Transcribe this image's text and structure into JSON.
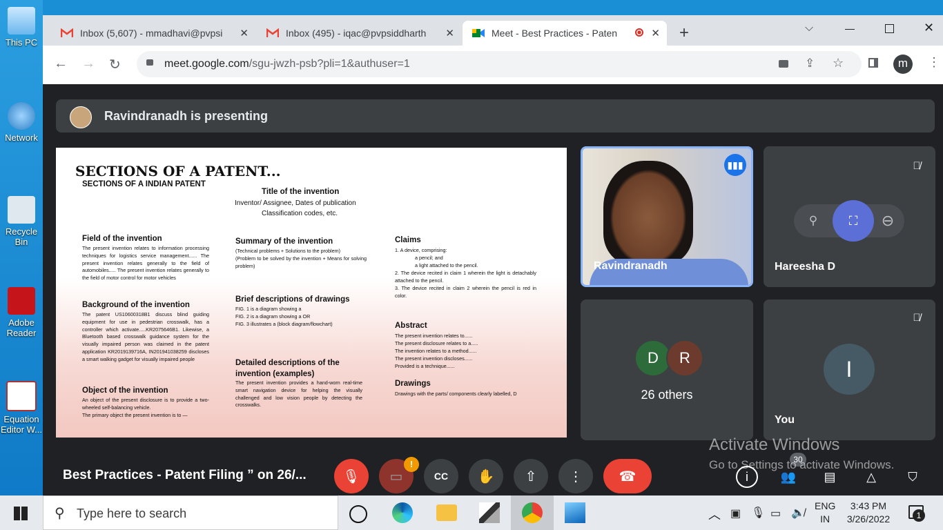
{
  "desktop": {
    "icons": [
      {
        "label": "This PC"
      },
      {
        "label": "Network"
      },
      {
        "label": "Recycle Bin"
      },
      {
        "label": "Adobe Reader"
      },
      {
        "label": "Equation Editor W..."
      }
    ]
  },
  "browser": {
    "tabs": [
      {
        "title": "Inbox (5,607) - mmadhavi@pvpsi",
        "icon": "gmail-icon"
      },
      {
        "title": "Inbox (495) - iqac@pvpsiddharth",
        "icon": "gmail-icon"
      },
      {
        "title": "Meet - Best Practices - Paten",
        "icon": "meet-icon",
        "active": true
      }
    ],
    "new_tab": "+",
    "url_host": "meet.google.com",
    "url_path": "/sgu-jwzh-psb?pli=1&authuser=1",
    "profile_initial": "m"
  },
  "meet": {
    "banner_text": "Ravindranadh is presenting",
    "slide": {
      "title": "SECTIONS OF A PATENT...",
      "subtitle": "SECTIONS OF A INDIAN PATENT",
      "title_invention": "Title of the invention",
      "title_lines": [
        "Inventor/ Assignee, Dates of publication",
        "Classification codes, etc."
      ],
      "field_head": "Field of the invention",
      "field_body": "The present invention relates to information processing techniques for logistics service management...... The present invention relates generally to the field of automobiles..... The present invention relates generally to the field of motor control for motor vehicles",
      "background_head": "Background of the invention",
      "background_body": "The patent US10600318B1 discuss blind guiding equipment for use in pedestrian crosswalk, has a controller which activate.....KR2075646B1. Likewise, a Bluetooth based crosswalk guidance system for the visually impaired person was claimed in the patent application KR2019139716A, IN201941038259 discloses a smart walking gadget for visually impaired people",
      "object_head": "Object of the invention",
      "object_body": [
        "An object of the present disclosure is to provide a two-wheeled self-balancing vehicle.",
        "The primary object the present invention is to —"
      ],
      "summary_head": "Summary of the invention",
      "summary_body": [
        "(Technical problems + Solutions to the problem)",
        "(Problem to be solved by the invention + Means for solving problem)"
      ],
      "brief_head": "Brief descriptions of drawings",
      "brief_body": [
        "FIG. 1 is a diagram showing a",
        "FIG. 2 is a diagram showing a OR",
        "FIG. 3 illustrates a (block diagram/flowchart)"
      ],
      "detailed_head": "Detailed descriptions of the invention (examples)",
      "detailed_body": "The present invention provides a hand-worn real-time smart navigation device for helping the visually challenged and low vision people by detecting the crosswalks.",
      "claims_head": "Claims",
      "claims_body": [
        "1. A device, comprising:",
        "a pencil; and",
        "a light attached to the pencil.",
        "2.   The device recited in claim 1 wherein the light is detachably attached to the pencil.",
        "3.   The device recited in claim 2 wherein the pencil is red in color."
      ],
      "abstract_head": "Abstract",
      "abstract_body": [
        "The present invention relates to......",
        "The present disclosure relates to a.....",
        "The invention relates to a method......",
        "The present invention discloses......",
        "Provided is a technique......"
      ],
      "drawings_head": "Drawings",
      "drawings_body": "Drawings with the parts/ components clearly labelled, D"
    },
    "participants": {
      "presenter": "Ravindranadh",
      "second": "Hareesha D",
      "others_label": "26 others",
      "others_avatars": [
        {
          "initial": "D",
          "color": "#2e6b3a"
        },
        {
          "initial": "R",
          "color": "#6d3b2e"
        }
      ],
      "you_label": "You",
      "you_initial": "I"
    },
    "meeting_title": "Best Practices - Patent Filing ” on 26/...",
    "people_count": "30",
    "camera_alert": "!"
  },
  "watermark": {
    "line1": "Activate Windows",
    "line2": "Go to Settings to activate Windows."
  },
  "taskbar": {
    "search_placeholder": "Type here to search",
    "lang_top": "ENG",
    "lang_bottom": "IN",
    "time": "3:43 PM",
    "date": "3/26/2022",
    "notif_count": "1"
  },
  "colors": {
    "meet_bg": "#202124",
    "tile": "#3c4043",
    "red": "#ea4335",
    "accent_blue": "#8ab4f8"
  }
}
